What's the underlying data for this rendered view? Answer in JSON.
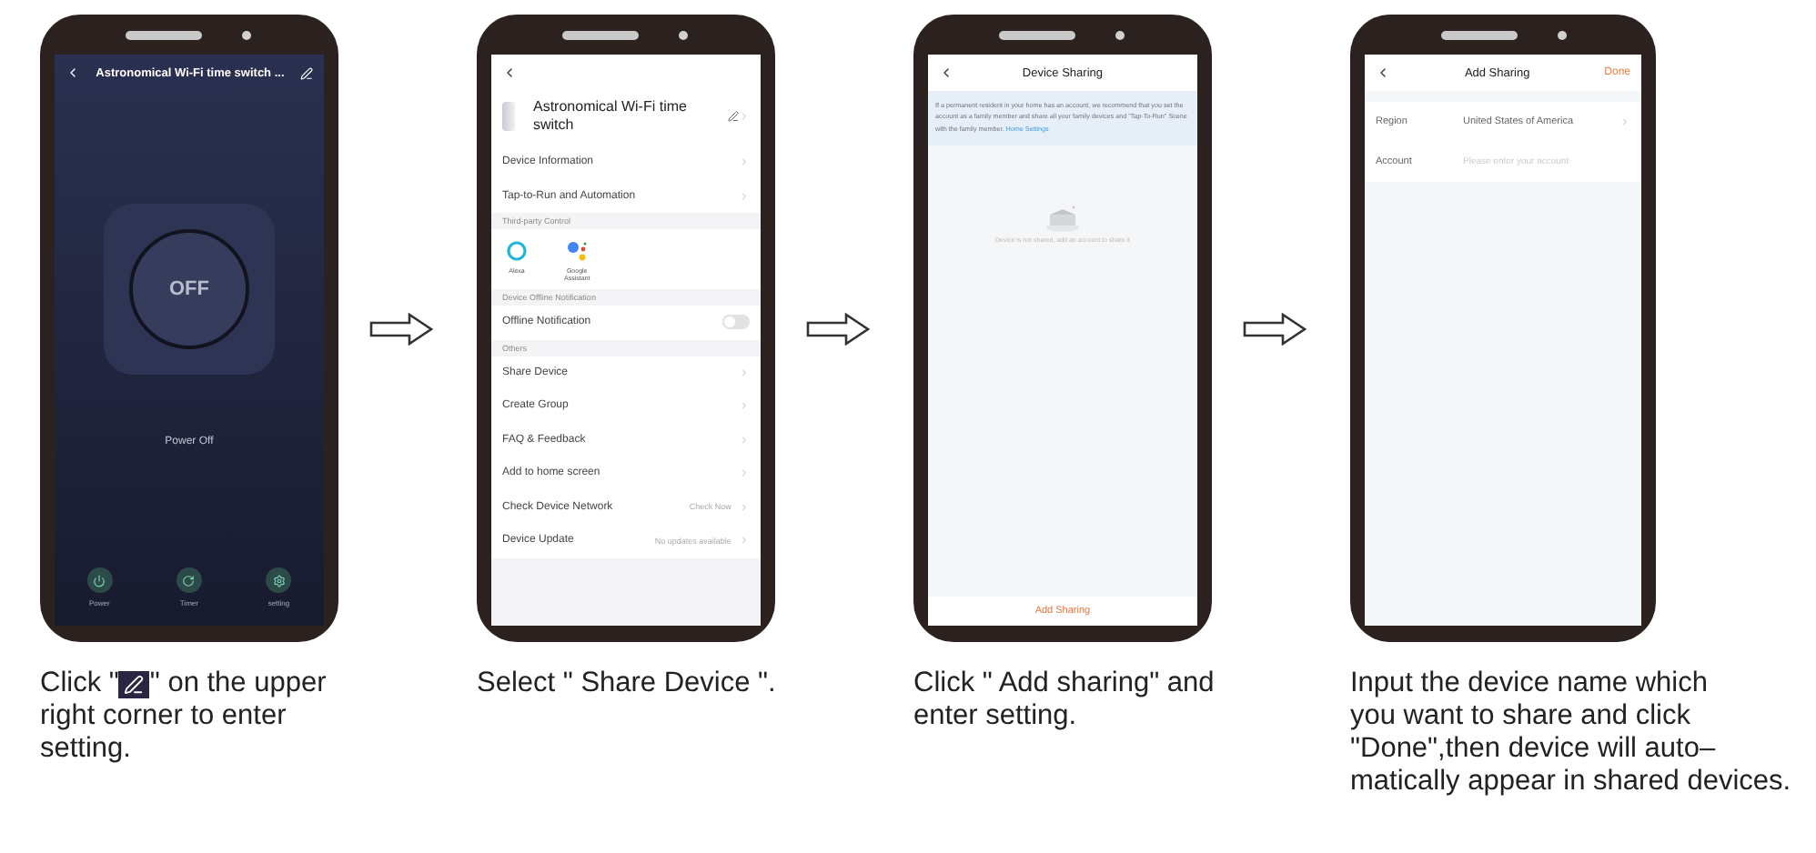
{
  "steps": [
    {
      "kind": "control",
      "screen": {
        "title": "Astronomical Wi-Fi time switch ...",
        "power_button": "OFF",
        "status": "Power Off",
        "actions": [
          {
            "kind": "power",
            "label": "Power"
          },
          {
            "kind": "timer",
            "label": "Timer"
          },
          {
            "kind": "setting",
            "label": "setting"
          }
        ]
      },
      "caption": {
        "before": "Click \"",
        "after": "\" on the upper",
        "rest": "right corner to enter\nsetting."
      }
    },
    {
      "kind": "settings",
      "screen": {
        "device_name": "Astronomical Wi-Fi time switch",
        "sections": [
          {
            "rows": [
              {
                "kind": "link",
                "label": "Device Information"
              },
              {
                "kind": "link",
                "label": "Tap-to-Run and Automation"
              }
            ]
          },
          {
            "heading": "Third-party Control",
            "rows": [
              {
                "kind": "services",
                "services": [
                  {
                    "kind": "alexa",
                    "label": "Alexa"
                  },
                  {
                    "kind": "google",
                    "label": "Google\nAssistant"
                  }
                ]
              }
            ]
          },
          {
            "heading": "Device Offline Notification",
            "rows": [
              {
                "kind": "toggle",
                "label": "Offline Notification",
                "on": false
              }
            ]
          },
          {
            "heading": "Others",
            "rows": [
              {
                "kind": "link",
                "label": "Share Device"
              },
              {
                "kind": "link",
                "label": "Create Group"
              },
              {
                "kind": "link",
                "label": "FAQ & Feedback"
              },
              {
                "kind": "link",
                "label": "Add to home screen"
              },
              {
                "kind": "link",
                "label": "Check Device Network",
                "value": "Check Now"
              },
              {
                "kind": "link",
                "label": "Device Update",
                "value": "No updates available"
              }
            ]
          }
        ]
      },
      "caption": {
        "after": "Select \" Share Device \"."
      }
    },
    {
      "kind": "sharing",
      "screen": {
        "title": "Device Sharing",
        "notice": "If a permanent resident in your home has an account, we recommend that you set the account as a family member and share all your family devices and \"Tap-To-Run\" Scene with the family member.",
        "notice_link": "Home Settings",
        "empty_text": "Device is not shared, add an account to share it",
        "button": "Add Sharing"
      },
      "caption": {
        "after": "Click \" Add sharing\" and\nenter setting."
      }
    },
    {
      "kind": "add",
      "screen": {
        "title": "Add Sharing",
        "done": "Done",
        "fields": [
          {
            "kind": "select",
            "label": "Region",
            "value": "United States of America"
          },
          {
            "kind": "input",
            "label": "Account",
            "placeholder": "Please enter your account"
          }
        ]
      },
      "caption": {
        "after": "Input the device name which\nyou want to share and click\n\"Done\",then device will auto–\nmatically appear in shared devices."
      }
    }
  ]
}
